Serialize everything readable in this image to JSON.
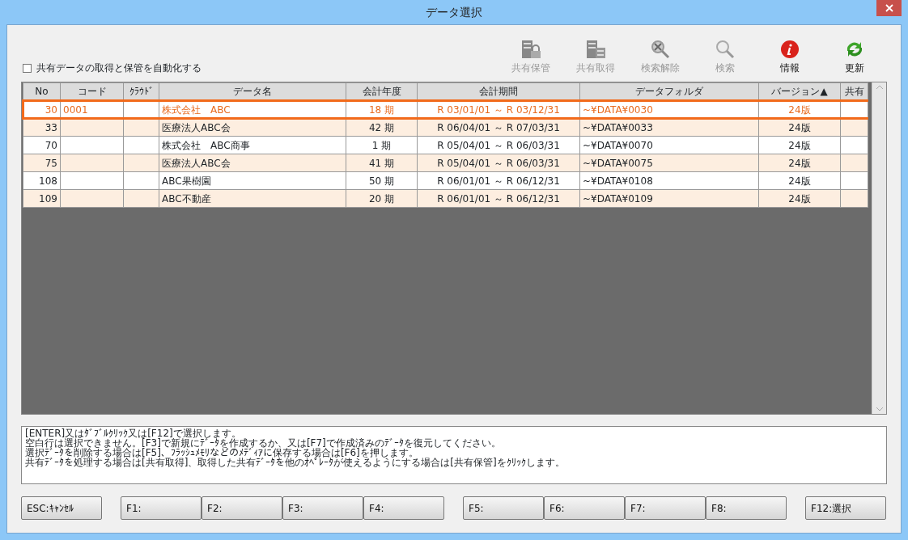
{
  "window": {
    "title": "データ選択"
  },
  "auto_share": {
    "label": "共有データの取得と保管を自動化する",
    "checked": false
  },
  "toolbar": [
    {
      "label": "共有保管",
      "kind": "store",
      "disabled": true
    },
    {
      "label": "共有取得",
      "kind": "fetch",
      "disabled": true
    },
    {
      "label": "検索解除",
      "kind": "unsearch",
      "disabled": true
    },
    {
      "label": "検索",
      "kind": "search",
      "disabled": true
    },
    {
      "label": "情報",
      "kind": "info",
      "disabled": false
    },
    {
      "label": "更新",
      "kind": "refresh",
      "disabled": false
    }
  ],
  "table": {
    "columns": [
      "No",
      "コード",
      "ｸﾗｳﾄﾞ",
      "データ名",
      "会計年度",
      "会計期間",
      "データフォルダ",
      "バージョン▲",
      "共有"
    ],
    "rows": [
      {
        "selected": true,
        "cells": [
          "30",
          "0001",
          "",
          "株式会社　ABC",
          "18 期",
          "R 03/01/01 ～ R 03/12/31",
          "~¥DATA¥0030",
          "24版",
          ""
        ]
      },
      {
        "selected": false,
        "cells": [
          "33",
          "",
          "",
          "医療法人ABC会",
          "42 期",
          "R 06/04/01 ～ R 07/03/31",
          "~¥DATA¥0033",
          "24版",
          ""
        ]
      },
      {
        "selected": false,
        "cells": [
          "70",
          "",
          "",
          "株式会社　ABC商事",
          "1 期",
          "R 05/04/01 ～ R 06/03/31",
          "~¥DATA¥0070",
          "24版",
          ""
        ]
      },
      {
        "selected": false,
        "cells": [
          "75",
          "",
          "",
          "医療法人ABC会",
          "41 期",
          "R 05/04/01 ～ R 06/03/31",
          "~¥DATA¥0075",
          "24版",
          ""
        ]
      },
      {
        "selected": false,
        "cells": [
          "108",
          "",
          "",
          "ABC果樹園",
          "50 期",
          "R 06/01/01 ～ R 06/12/31",
          "~¥DATA¥0108",
          "24版",
          ""
        ]
      },
      {
        "selected": false,
        "cells": [
          "109",
          "",
          "",
          "ABC不動産",
          "20 期",
          "R 06/01/01 ～ R 06/12/31",
          "~¥DATA¥0109",
          "24版",
          ""
        ]
      }
    ]
  },
  "messages": [
    "[ENTER]又はﾀﾞﾌﾞﾙｸﾘｯｸ又は[F12]で選択します。",
    "空白行は選択できません。[F3]で新規にﾃﾞｰﾀを作成するか、又は[F7]で作成済みのﾃﾞｰﾀを復元してください。",
    "選択ﾃﾞｰﾀを削除する場合は[F5]、ﾌﾗｯｼｭﾒﾓﾘなどのﾒﾃﾞｨｱに保存する場合は[F6]を押します。",
    "共有ﾃﾞｰﾀを処理する場合は[共有取得]、取得した共有ﾃﾞｰﾀを他のｵﾍﾟﾚｰﾀが使えるようにする場合は[共有保管]をｸﾘｯｸします。"
  ],
  "function_keys": [
    [
      "ESC:ｷｬﾝｾﾙ"
    ],
    [
      "F1:",
      "F2:",
      "F3:",
      "F4:"
    ],
    [
      "F5:",
      "F6:",
      "F7:",
      "F8:"
    ],
    [
      "F12:選択"
    ]
  ]
}
